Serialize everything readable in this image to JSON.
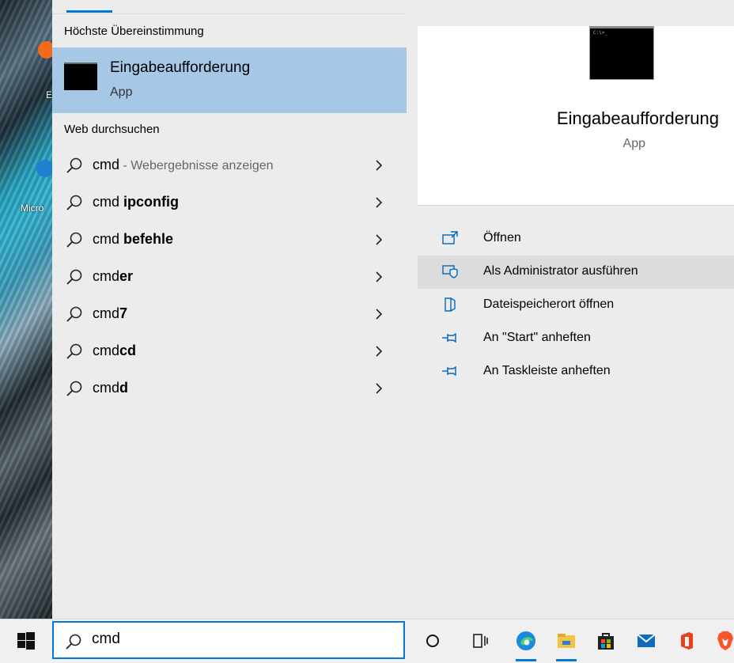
{
  "desktop": {
    "icon_labels": [
      "E",
      "Micro"
    ]
  },
  "search_results": {
    "best_match_heading": "Höchste Übereinstimmung",
    "best_match": {
      "name": "Eingabeaufforderung",
      "type": "App"
    },
    "web_heading": "Web durchsuchen",
    "web_items": [
      {
        "prefix": "cmd",
        "bold": "",
        "hint": " - Webergebnisse anzeigen"
      },
      {
        "prefix": "cmd ",
        "bold": "ipconfig",
        "hint": ""
      },
      {
        "prefix": "cmd ",
        "bold": "befehle",
        "hint": ""
      },
      {
        "prefix": "cmd",
        "bold": "er",
        "hint": ""
      },
      {
        "prefix": "cmd",
        "bold": "7",
        "hint": ""
      },
      {
        "prefix": "cmd",
        "bold": "cd",
        "hint": ""
      },
      {
        "prefix": "cmd",
        "bold": "d",
        "hint": ""
      }
    ]
  },
  "preview": {
    "icon_text": "C:\\>_",
    "name": "Eingabeaufforderung",
    "type": "App",
    "actions": [
      {
        "label": "Öffnen",
        "icon": "open-icon"
      },
      {
        "label": "Als Administrator ausführen",
        "icon": "shield-icon"
      },
      {
        "label": "Dateispeicherort öffnen",
        "icon": "file-location-icon"
      },
      {
        "label": "An \"Start\" anheften",
        "icon": "pin-icon"
      },
      {
        "label": "An Taskleiste anheften",
        "icon": "pin-icon"
      }
    ],
    "hovered_action_index": 1
  },
  "taskbar": {
    "search_value": "cmd",
    "icons": [
      "cortana-icon",
      "task-view-icon",
      "edge-icon",
      "file-explorer-icon",
      "store-icon",
      "mail-icon",
      "office-icon",
      "brave-icon"
    ]
  },
  "colors": {
    "accent": "#0078d4",
    "selection": "#a6c8e6",
    "panel": "#ececec",
    "hover": "#dcdcdc"
  }
}
